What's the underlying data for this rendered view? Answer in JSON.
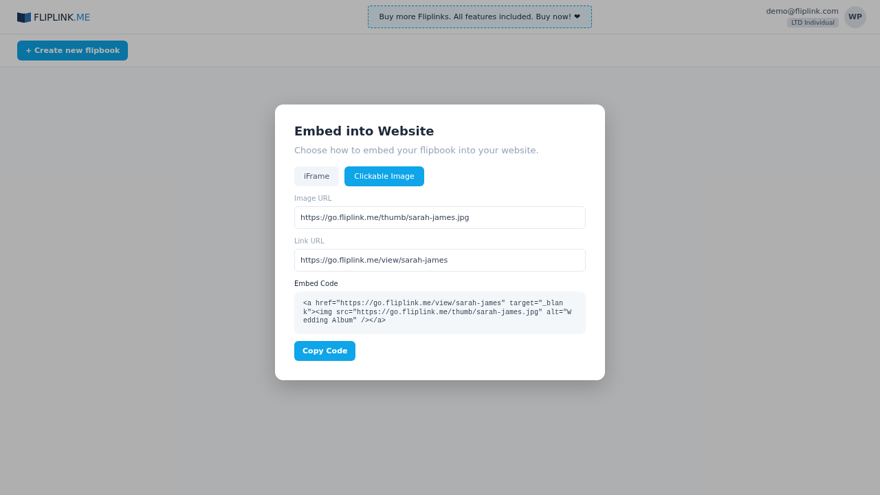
{
  "header": {
    "logo": {
      "brand": "FLIPLINK",
      "suffix": ".ME"
    },
    "promo": "Buy more Fliplinks. All features included. Buy now! ❤",
    "user": {
      "email": "demo@fliplink.com",
      "plan": "LTD Individual",
      "initials": "WP"
    }
  },
  "toolbar": {
    "create_button": "+ Create new flipbook"
  },
  "modal": {
    "title": "Embed into Website",
    "subtitle": "Choose how to embed your flipbook into your website.",
    "tabs": [
      {
        "label": "iFrame",
        "selected": false
      },
      {
        "label": "Clickable Image",
        "selected": true
      }
    ],
    "fields": [
      {
        "label": "Image URL",
        "value": "https://go.fliplink.me/thumb/sarah-james.jpg"
      },
      {
        "label": "Link URL",
        "value": "https://go.fliplink.me/view/sarah-james"
      }
    ],
    "code_label": "Embed Code",
    "code": "<a href=\"https://go.fliplink.me/view/sarah-james\" target=\"_blank\"><img src=\"https://go.fliplink.me/thumb/sarah-james.jpg\" alt=\"Wedding Album\" /></a>",
    "copy_button": "Copy Code"
  }
}
